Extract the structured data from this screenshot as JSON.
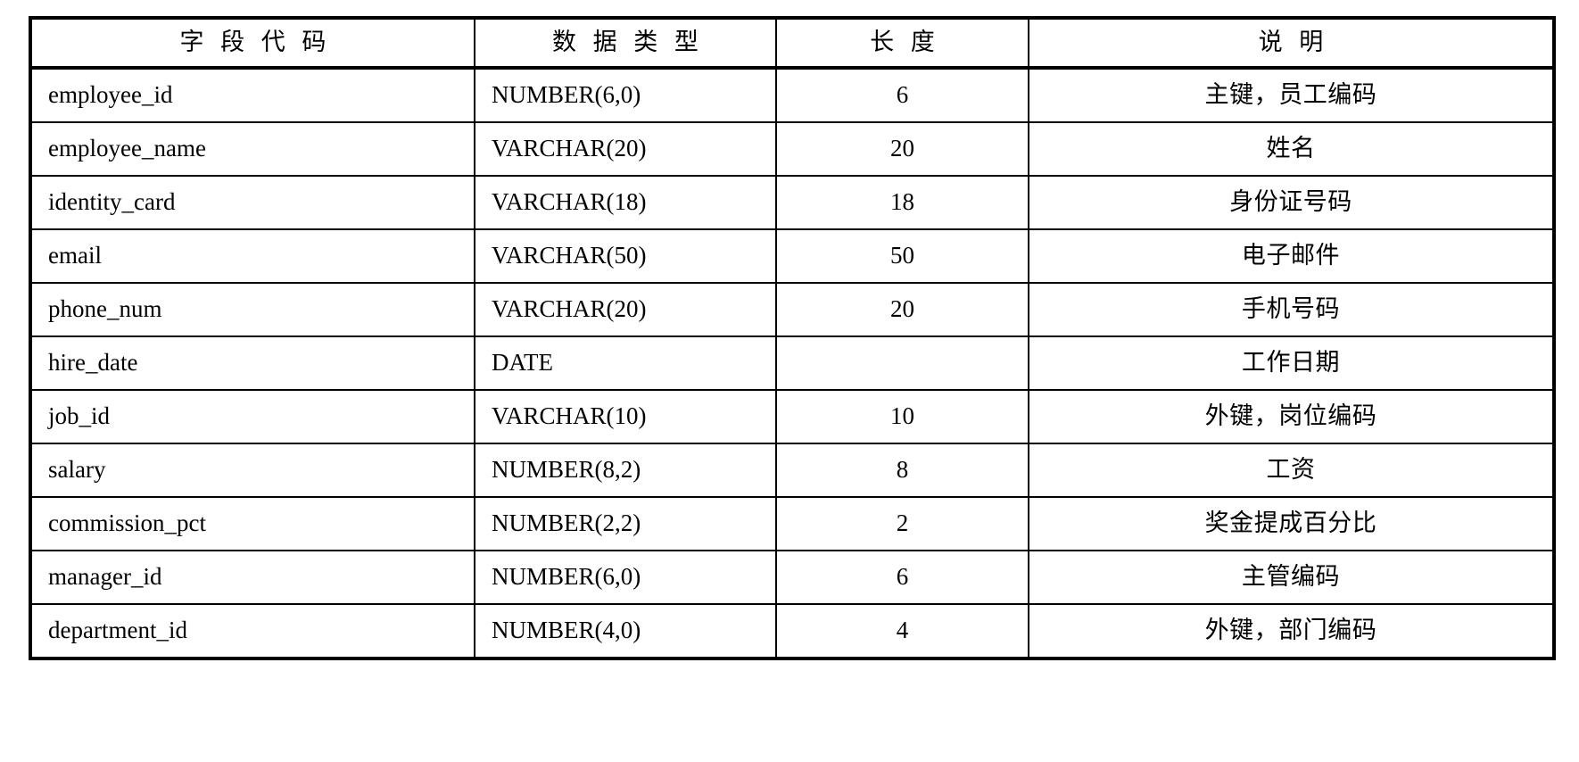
{
  "table": {
    "columns": [
      {
        "key": "field",
        "label": "字 段 代 码",
        "align": "left"
      },
      {
        "key": "type",
        "label": "数 据 类 型",
        "align": "left"
      },
      {
        "key": "length",
        "label": "长    度",
        "align": "center"
      },
      {
        "key": "desc",
        "label": "说    明",
        "align": "center"
      }
    ],
    "rows": [
      {
        "field": "employee_id",
        "type": "NUMBER(6,0)",
        "length": "6",
        "desc": "主键，员工编码"
      },
      {
        "field": "employee_name",
        "type": "VARCHAR(20)",
        "length": "20",
        "desc": "姓名"
      },
      {
        "field": "identity_card",
        "type": "VARCHAR(18)",
        "length": "18",
        "desc": "身份证号码"
      },
      {
        "field": "email",
        "type": "VARCHAR(50)",
        "length": "50",
        "desc": "电子邮件"
      },
      {
        "field": "phone_num",
        "type": "VARCHAR(20)",
        "length": "20",
        "desc": "手机号码"
      },
      {
        "field": "hire_date",
        "type": "DATE",
        "length": "",
        "desc": "工作日期"
      },
      {
        "field": "job_id",
        "type": "VARCHAR(10)",
        "length": "10",
        "desc": "外键，岗位编码"
      },
      {
        "field": "salary",
        "type": "NUMBER(8,2)",
        "length": "8",
        "desc": "工资"
      },
      {
        "field": "commission_pct",
        "type": "NUMBER(2,2)",
        "length": "2",
        "desc": "奖金提成百分比"
      },
      {
        "field": "manager_id",
        "type": "NUMBER(6,0)",
        "length": "6",
        "desc": "主管编码"
      },
      {
        "field": "department_id",
        "type": "NUMBER(4,0)",
        "length": "4",
        "desc": "外键，部门编码"
      }
    ]
  },
  "colors": {
    "background": "#ffffff",
    "text": "#000000",
    "border": "#000000"
  }
}
